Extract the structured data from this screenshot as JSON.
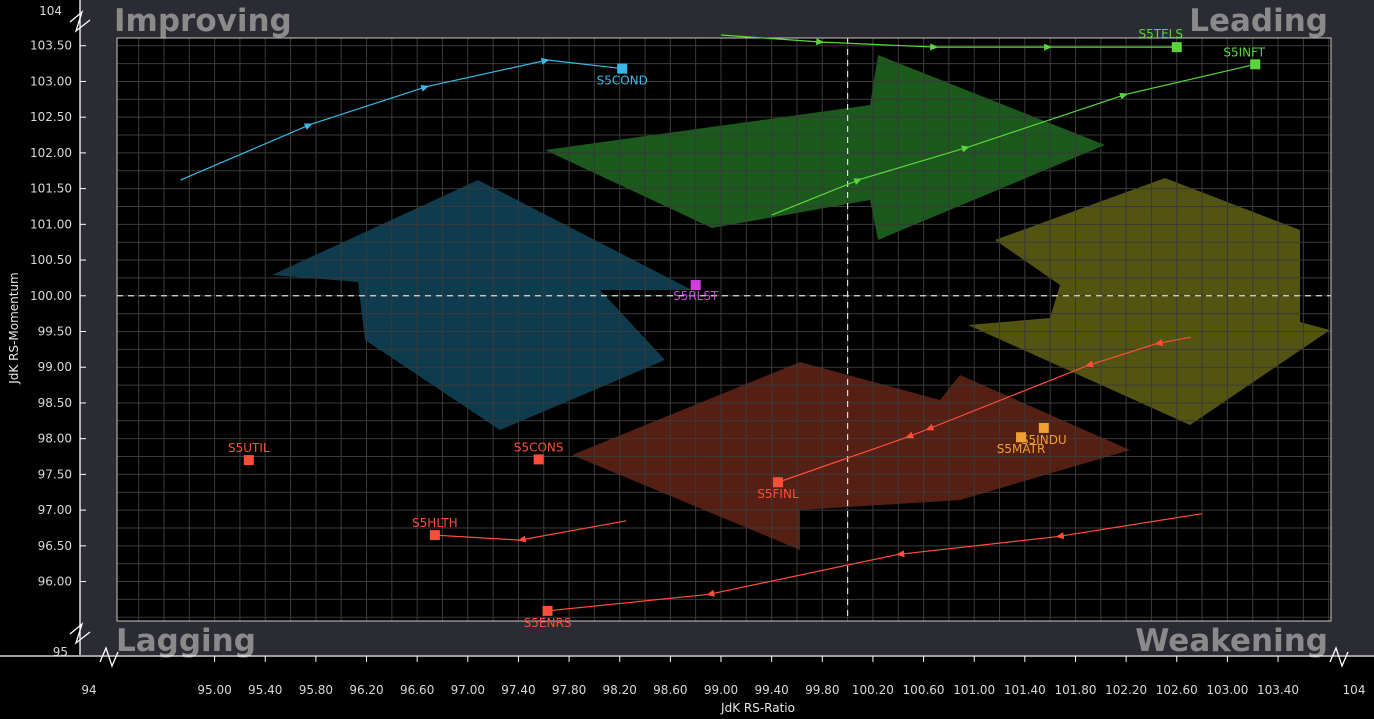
{
  "chart_data": {
    "type": "scatter",
    "xlabel": "JdK RS-Ratio",
    "ylabel": "JdK RS-Momentum",
    "xlim": [
      94,
      104
    ],
    "ylim": [
      95,
      104
    ],
    "x_ticks": [
      "95.00",
      "95.40",
      "95.80",
      "96.20",
      "96.60",
      "97.00",
      "97.40",
      "97.80",
      "98.20",
      "98.60",
      "99.00",
      "99.40",
      "99.80",
      "100.20",
      "100.60",
      "101.00",
      "101.40",
      "101.80",
      "102.20",
      "102.60",
      "103.00",
      "103.40"
    ],
    "x_tick_values": [
      95.0,
      95.4,
      95.8,
      96.2,
      96.6,
      97.0,
      97.4,
      97.8,
      98.2,
      98.6,
      99.0,
      99.4,
      99.8,
      100.2,
      100.6,
      101.0,
      101.4,
      101.8,
      102.2,
      102.6,
      103.0,
      103.4
    ],
    "x_end_labels": [
      "94",
      "104"
    ],
    "y_ticks": [
      "96.00",
      "96.50",
      "97.00",
      "97.50",
      "98.00",
      "98.50",
      "99.00",
      "99.50",
      "100.00",
      "100.50",
      "101.00",
      "101.50",
      "102.00",
      "102.50",
      "103.00",
      "103.50"
    ],
    "y_tick_values": [
      96.0,
      96.5,
      97.0,
      97.5,
      98.0,
      98.5,
      99.0,
      99.5,
      100.0,
      100.5,
      101.0,
      101.5,
      102.0,
      102.5,
      103.0,
      103.5
    ],
    "y_end_labels": [
      "95",
      "104"
    ],
    "reference_lines": {
      "x": 100,
      "y": 100
    },
    "grid": true,
    "quadrants": {
      "top_left": "Improving",
      "top_right": "Leading",
      "bottom_left": "Lagging",
      "bottom_right": "Weakening"
    },
    "series": [
      {
        "name": "S5TELS",
        "color": "#5ad63c",
        "x": [
          99.0,
          99.8,
          100.7,
          101.6,
          102.6
        ],
        "y": [
          103.65,
          103.55,
          103.48,
          103.48,
          103.48
        ]
      },
      {
        "name": "S5INFT",
        "color": "#5ad63c",
        "x": [
          99.4,
          100.1,
          100.95,
          102.2,
          103.22
        ],
        "y": [
          101.13,
          101.63,
          102.08,
          102.82,
          103.24
        ]
      },
      {
        "name": "S5COND",
        "color": "#3ab8e8",
        "x": [
          94.73,
          95.76,
          96.68,
          97.63,
          98.22
        ],
        "y": [
          101.62,
          102.4,
          102.93,
          103.3,
          103.18
        ]
      },
      {
        "name": "S5RLST",
        "color": "#d040e0",
        "x": [
          98.8
        ],
        "y": [
          100.15
        ]
      },
      {
        "name": "S5INDU",
        "color": "#f0a030",
        "x": [
          101.55
        ],
        "y": [
          98.15
        ]
      },
      {
        "name": "S5MATR",
        "color": "#f0a030",
        "x": [
          101.37
        ],
        "y": [
          98.02
        ]
      },
      {
        "name": "S5FINL",
        "color": "#ff4d3a",
        "x": [
          102.71,
          102.44,
          101.89,
          100.63,
          100.47,
          99.45
        ],
        "y": [
          99.42,
          99.33,
          99.02,
          98.13,
          98.02,
          97.39
        ]
      },
      {
        "name": "S5HLTH",
        "color": "#ff4d3a",
        "x": [
          98.25,
          97.41,
          96.74
        ],
        "y": [
          96.85,
          96.58,
          96.65
        ]
      },
      {
        "name": "S5ENRS",
        "color": "#ff4d3a",
        "x": [
          102.8,
          101.66,
          100.4,
          98.9,
          97.63
        ],
        "y": [
          96.95,
          96.63,
          96.38,
          95.82,
          95.59
        ]
      },
      {
        "name": "S5CONS",
        "color": "#ff4d3a",
        "x": [
          97.56
        ],
        "y": [
          97.71
        ]
      },
      {
        "name": "S5UTIL",
        "color": "#ff4d3a",
        "x": [
          95.27
        ],
        "y": [
          97.7
        ]
      }
    ]
  }
}
